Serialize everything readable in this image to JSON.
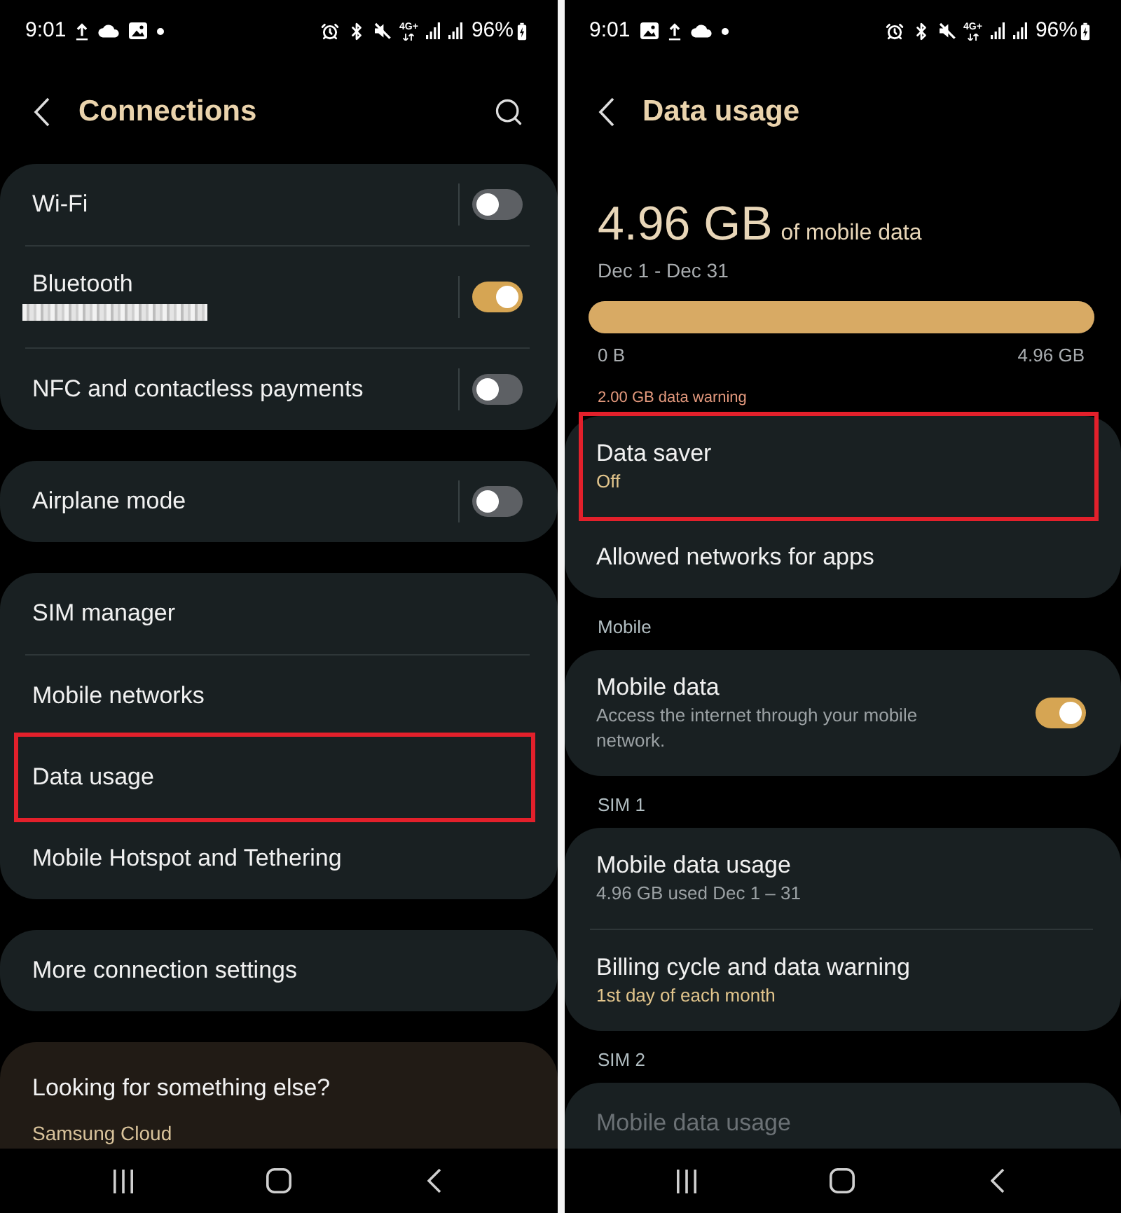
{
  "screens": [
    {
      "status_bar": {
        "time": "9:01",
        "notifications": [
          {
            "kind": "upload"
          },
          {
            "kind": "cloud"
          },
          {
            "kind": "image"
          },
          {
            "kind": "dot"
          }
        ],
        "indicators": [
          {
            "kind": "alarm"
          },
          {
            "kind": "bluetooth"
          },
          {
            "kind": "mute"
          },
          {
            "kind": "network",
            "label": "4G+"
          },
          {
            "kind": "signal"
          },
          {
            "kind": "signal"
          }
        ],
        "battery": "96%"
      },
      "header": {
        "title": "Connections",
        "search": true
      },
      "sections": [
        {
          "kind": "card",
          "items": [
            {
              "kind": "switch_link",
              "title": "Wi-Fi",
              "on": false,
              "highlighted": false,
              "disabled": false
            },
            {
              "kind": "switch_link",
              "title": "Bluetooth",
              "subtitle_redacted": true,
              "on": true,
              "highlighted": false,
              "disabled": false
            },
            {
              "kind": "switch_link",
              "title": "NFC and contactless payments",
              "on": false,
              "highlighted": false,
              "disabled": false
            }
          ]
        },
        {
          "kind": "card",
          "items": [
            {
              "kind": "switch_link",
              "title": "Airplane mode",
              "on": false,
              "highlighted": false,
              "disabled": false
            }
          ]
        },
        {
          "kind": "card",
          "items": [
            {
              "kind": "link",
              "title": "SIM manager",
              "highlighted": false,
              "disabled": false
            },
            {
              "kind": "link",
              "title": "Mobile networks",
              "highlighted": false,
              "disabled": false
            },
            {
              "kind": "link",
              "title": "Data usage",
              "highlighted": true,
              "disabled": false
            },
            {
              "kind": "link",
              "title": "Mobile Hotspot and Tethering",
              "highlighted": false,
              "disabled": false
            }
          ]
        },
        {
          "kind": "card",
          "items": [
            {
              "kind": "link",
              "title": "More connection settings",
              "highlighted": false,
              "disabled": false
            }
          ]
        },
        {
          "kind": "suggestions",
          "title": "Looking for something else?",
          "links": [
            "Samsung Cloud"
          ]
        }
      ]
    },
    {
      "status_bar": {
        "time": "9:01",
        "notifications": [
          {
            "kind": "image"
          },
          {
            "kind": "upload"
          },
          {
            "kind": "cloud"
          },
          {
            "kind": "dot"
          }
        ],
        "indicators": [
          {
            "kind": "alarm"
          },
          {
            "kind": "bluetooth"
          },
          {
            "kind": "mute"
          },
          {
            "kind": "network",
            "label": "4G+"
          },
          {
            "kind": "signal"
          },
          {
            "kind": "signal"
          }
        ],
        "battery": "96%"
      },
      "header": {
        "title": "Data usage",
        "search": false
      },
      "sections": [
        {
          "kind": "usage",
          "amount": "4.96 GB",
          "amount_label": "of mobile data",
          "period": "Dec 1 - Dec 31",
          "level": 1,
          "min_label": "0 B",
          "max_label": "4.96 GB",
          "warning": "2.00 GB data warning"
        },
        {
          "kind": "card",
          "items": [
            {
              "kind": "link",
              "title": "Data saver",
              "subtitle": "Off",
              "subtitle_accent": true,
              "highlighted": true,
              "disabled": false
            },
            {
              "kind": "link",
              "title": "Allowed networks for apps",
              "highlighted": false,
              "disabled": false
            }
          ]
        },
        {
          "kind": "heading",
          "text": "Mobile"
        },
        {
          "kind": "card",
          "items": [
            {
              "kind": "switch",
              "title": "Mobile data",
              "subtitle": "Access the internet through your mobile network.",
              "subtitle_accent": false,
              "on": true,
              "highlighted": false,
              "disabled": false
            }
          ]
        },
        {
          "kind": "heading",
          "text": "SIM 1"
        },
        {
          "kind": "card",
          "items": [
            {
              "kind": "link",
              "title": "Mobile data usage",
              "subtitle": "4.96 GB used Dec 1 – 31",
              "subtitle_accent": false,
              "highlighted": false,
              "disabled": false
            },
            {
              "kind": "link",
              "title": "Billing cycle and data warning",
              "subtitle": "1st day of each month",
              "subtitle_accent": true,
              "highlighted": false,
              "disabled": false
            }
          ]
        },
        {
          "kind": "heading",
          "text": "SIM 2"
        },
        {
          "kind": "card",
          "items": [
            {
              "kind": "link",
              "title": "Mobile data usage",
              "highlighted": false,
              "disabled": true
            }
          ]
        }
      ]
    }
  ]
}
